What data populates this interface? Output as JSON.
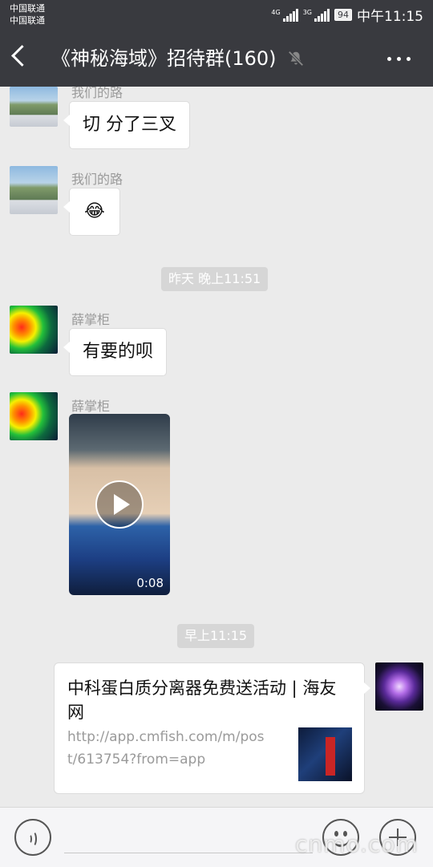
{
  "status_bar": {
    "carrier_1": "中国联通",
    "carrier_2": "中国联通",
    "sim1_network": "4G",
    "sim2_network": "3G",
    "battery": "94",
    "time": "中午11:15"
  },
  "header": {
    "back_icon": "back-arrow-icon",
    "title": "《神秘海域》招待群(160)",
    "mute_icon": "bell-muted-icon",
    "more_icon": "more-dots-icon",
    "bar_color": "#393a3f"
  },
  "messages": [
    {
      "sender": "我们的路",
      "text": "切 分了三叉"
    },
    {
      "sender": "我们的路",
      "emoji": "😂"
    },
    {
      "timestamp": "昨天 晚上11:51"
    },
    {
      "sender": "薛掌柜",
      "text": "有要的呗"
    },
    {
      "sender": "薛掌柜",
      "video_duration": "0:08"
    },
    {
      "timestamp": "早上11:15"
    },
    {
      "link_title": "中科蛋白质分离器免费送活动 | 海友网",
      "link_url": "http://app.cmfish.com/m/post/613754?from=app"
    }
  ],
  "input_bar": {
    "voice_icon": "voice-input-icon",
    "emoji_icon": "emoji-icon",
    "plus_icon": "plus-icon"
  },
  "watermark": "cnmo.com"
}
